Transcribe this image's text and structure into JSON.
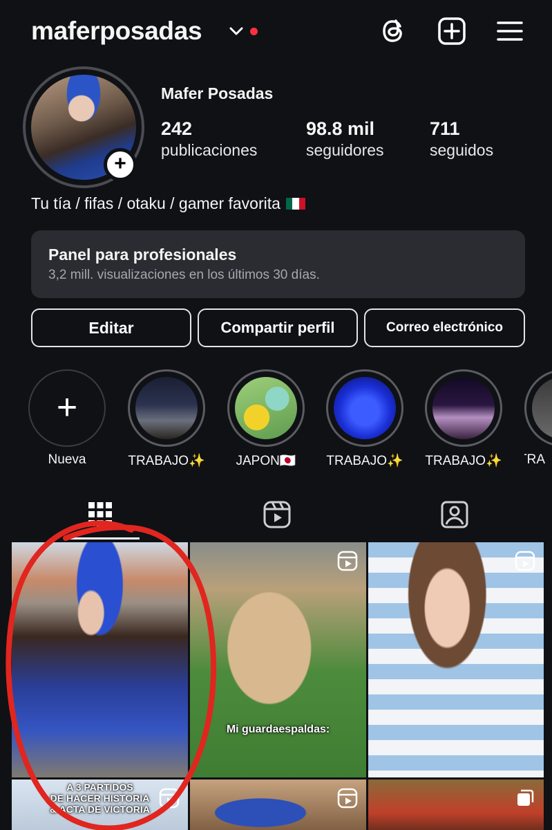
{
  "header": {
    "username": "maferposadas",
    "icons": [
      "chevron-down-icon",
      "threads-icon",
      "new-post-icon",
      "menu-icon"
    ],
    "notification_color": "#ff3040"
  },
  "profile": {
    "display_name": "Mafer Posadas",
    "stats": [
      {
        "value": "242",
        "label": "publicaciones"
      },
      {
        "value": "98.8 mil",
        "label": "seguidores"
      },
      {
        "value": "711",
        "label": "seguidos"
      }
    ],
    "bio": "Tu tía / fifas / otaku / gamer favorita",
    "bio_flag": "mexico-flag"
  },
  "pro_panel": {
    "title": "Panel para profesionales",
    "subtitle": "3,2 mill. visualizaciones en los últimos 30 días."
  },
  "buttons": {
    "edit": "Editar",
    "share": "Compartir perfil",
    "email": "Correo electrónico"
  },
  "highlights": [
    {
      "label": "Nueva"
    },
    {
      "label": "TRABAJO✨"
    },
    {
      "label": "JAPON🇯🇵"
    },
    {
      "label": "TRABAJO✨"
    },
    {
      "label": "TRABAJO✨"
    },
    {
      "label": "TRA"
    }
  ],
  "tabs": [
    "grid-icon",
    "reels-icon",
    "tagged-icon"
  ],
  "grid": {
    "captions": {
      "reel_1": "Mi guardaespaldas:",
      "post_4_line1": "A 3 PARTIDOS",
      "post_4_line2": "DE HACER HISTORIA",
      "post_4_line3": "& ACTA DE VICTORIA"
    }
  },
  "colors": {
    "background": "#0f1115",
    "panel": "#2a2c31",
    "annotation": "#e0261f"
  }
}
